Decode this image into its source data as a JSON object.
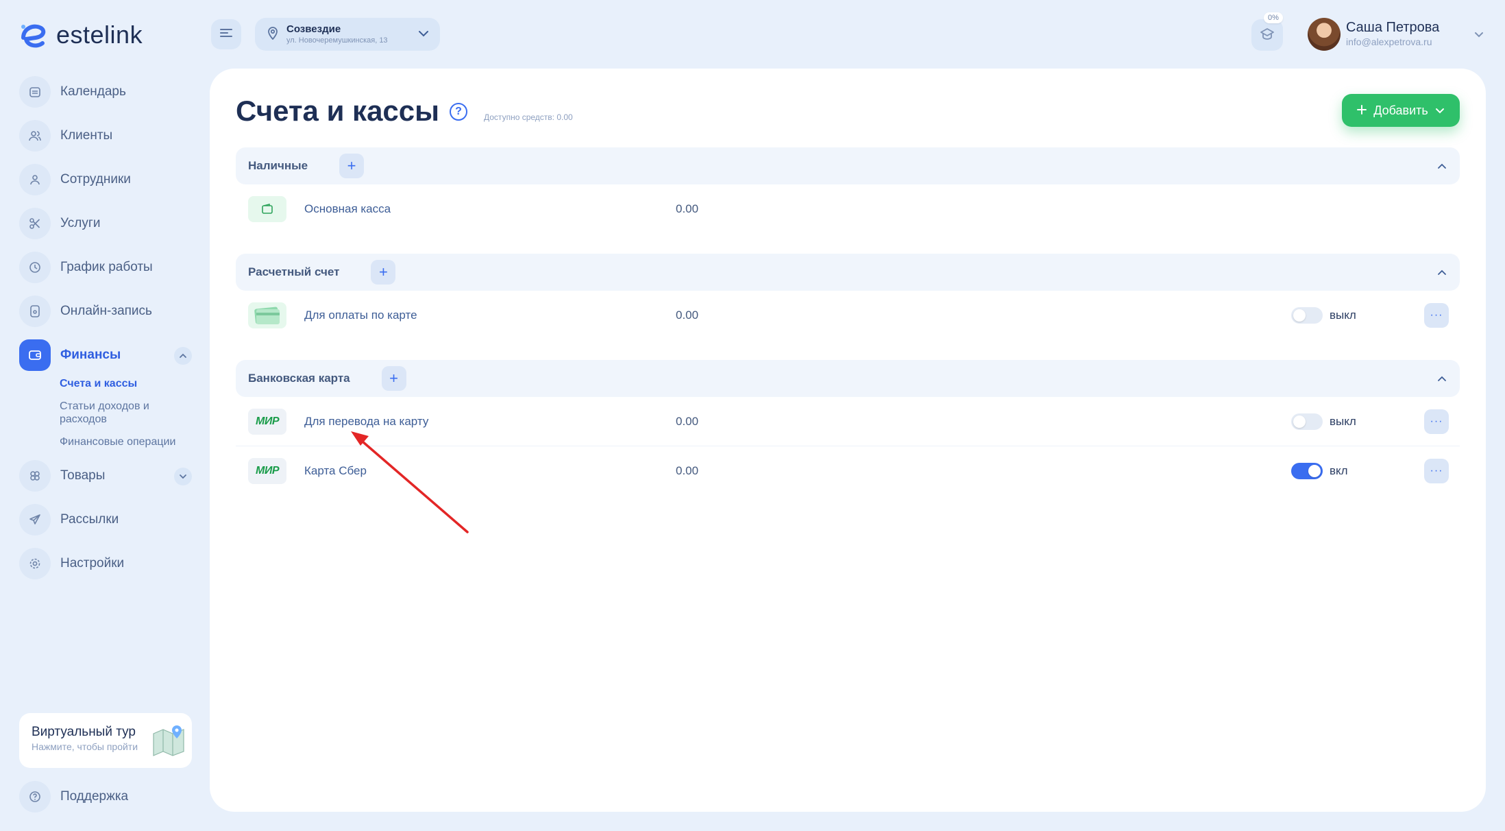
{
  "app": {
    "logo_text": "estelink"
  },
  "header": {
    "location_name": "Созвездие",
    "location_address": "ул. Новочеремушкинская, 13",
    "progress_label": "0%",
    "user_name": "Саша Петрова",
    "user_email": "info@alexpetrova.ru"
  },
  "sidebar": {
    "items": [
      {
        "label": "Календарь",
        "icon": "calendar-icon"
      },
      {
        "label": "Клиенты",
        "icon": "clients-icon"
      },
      {
        "label": "Сотрудники",
        "icon": "employee-icon"
      },
      {
        "label": "Услуги",
        "icon": "scissors-icon"
      },
      {
        "label": "График работы",
        "icon": "clock-icon"
      },
      {
        "label": "Онлайн-запись",
        "icon": "online-booking-icon"
      },
      {
        "label": "Финансы",
        "icon": "wallet-icon",
        "active": true
      },
      {
        "label": "Товары",
        "icon": "products-icon"
      },
      {
        "label": "Рассылки",
        "icon": "send-icon"
      },
      {
        "label": "Настройки",
        "icon": "gear-icon"
      }
    ],
    "finance_sub": [
      {
        "label": "Счета и кассы",
        "active": true
      },
      {
        "label": "Статьи доходов и расходов"
      },
      {
        "label": "Финансовые операции"
      }
    ],
    "tour_title": "Виртуальный тур",
    "tour_subtitle": "Нажмите, чтобы пройти",
    "support_label": "Поддержка"
  },
  "main": {
    "title": "Счета и кассы",
    "available": "Доступно средств: 0.00",
    "add_button": "Добавить",
    "sections": [
      {
        "title": "Наличные",
        "rows": [
          {
            "name": "Основная касса",
            "amount": "0.00",
            "icon": "wallet-icon"
          }
        ]
      },
      {
        "title": "Расчетный счет",
        "rows": [
          {
            "name": "Для оплаты по карте",
            "amount": "0.00",
            "icon": "card-icon",
            "toggle": false,
            "toggle_label": "выкл"
          }
        ]
      },
      {
        "title": "Банковская карта",
        "rows": [
          {
            "name": "Для перевода на карту",
            "amount": "0.00",
            "icon": "mir-logo",
            "logo_text": "МИР",
            "toggle": false,
            "toggle_label": "выкл"
          },
          {
            "name": "Карта Сбер",
            "amount": "0.00",
            "icon": "mir-logo",
            "logo_text": "МИР",
            "toggle": true,
            "toggle_label": "вкл"
          }
        ]
      }
    ]
  },
  "colors": {
    "accent": "#3a6df0",
    "add_button": "#2fc06a",
    "annotation_arrow": "#e32626"
  }
}
